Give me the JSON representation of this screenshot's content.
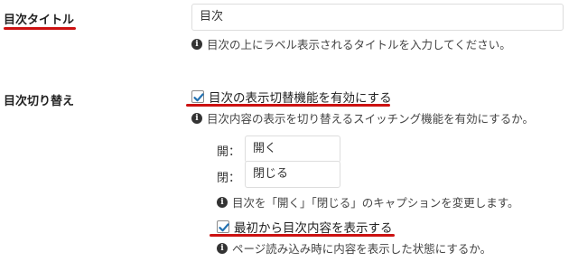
{
  "title_setting": {
    "label": "目次タイトル",
    "value": "目次",
    "info": "目次の上にラベル表示されるタイトルを入力してください。"
  },
  "toggle_setting": {
    "label": "目次切り替え",
    "enable_checkbox": {
      "label": "目次の表示切替機能を有効にする",
      "checked": true
    },
    "enable_info": "目次内容の表示を切り替えるスイッチング機能を有効にするか。",
    "open": {
      "label": "開：",
      "value": "開く"
    },
    "close": {
      "label": "閉：",
      "value": "閉じる"
    },
    "caption_info": "目次を「開く」「閉じる」のキャプションを変更します。",
    "initial_checkbox": {
      "label": "最初から目次内容を表示する",
      "checked": true
    },
    "initial_info": "ページ読み込み時に内容を表示した状態にするか。"
  },
  "colors": {
    "underline": "#cc1111",
    "checkbox_check": "#2271b1",
    "info_icon": "#333333"
  }
}
